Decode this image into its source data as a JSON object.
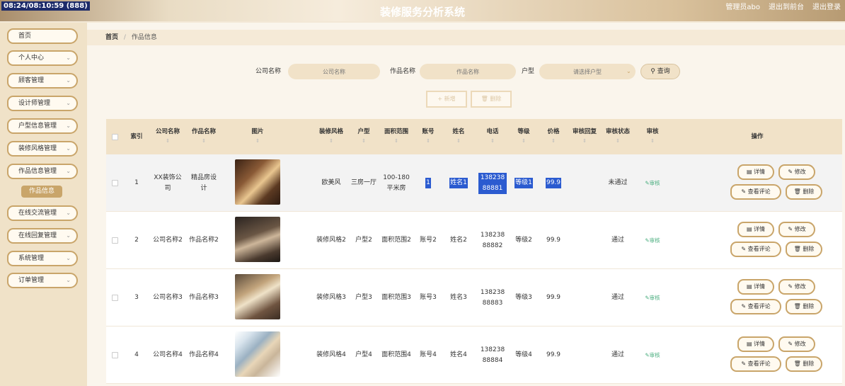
{
  "header": {
    "clock": "08:24/08:10:59 (888)",
    "title": "装修服务分析系统",
    "admin": "管理员abo",
    "back_to_front": "退出到前台",
    "logout": "退出登录"
  },
  "sidebar": {
    "items": [
      {
        "label": "首页",
        "has_arrow": false
      },
      {
        "label": "个人中心",
        "has_arrow": true
      },
      {
        "label": "顾客管理",
        "has_arrow": true
      },
      {
        "label": "设计师管理",
        "has_arrow": true
      },
      {
        "label": "户型信息管理",
        "has_arrow": true
      },
      {
        "label": "装修风格管理",
        "has_arrow": true
      },
      {
        "label": "作品信息管理",
        "has_arrow": true
      },
      {
        "label": "在线交流管理",
        "has_arrow": true
      },
      {
        "label": "在线回复管理",
        "has_arrow": true
      },
      {
        "label": "系统管理",
        "has_arrow": true
      },
      {
        "label": "订单管理",
        "has_arrow": true
      }
    ],
    "sub_active": "作品信息"
  },
  "breadcrumb": {
    "home": "首页",
    "sep": "/",
    "current": "作品信息"
  },
  "search": {
    "company_label": "公司名称",
    "company_placeholder": "公司名称",
    "work_label": "作品名称",
    "work_placeholder": "作品名称",
    "type_label": "户型",
    "type_placeholder": "请选择户型",
    "query_button": "查询"
  },
  "toolbar": {
    "add_label": "+ 新增",
    "delete_label": "删除"
  },
  "table": {
    "headers": [
      "索引",
      "公司名称",
      "作品名称",
      "图片",
      "装修风格",
      "户型",
      "面积范围",
      "账号",
      "姓名",
      "电话",
      "等级",
      "价格",
      "审核回复",
      "审核状态",
      "审核",
      "操作"
    ],
    "rows": [
      {
        "index": "1",
        "company": "XX装饰公司",
        "work": "精品房设计",
        "style": "欧美风",
        "type": "三房一厅",
        "area": "100-180平米房",
        "account": "1",
        "name": "姓名1",
        "phone": "13823888881",
        "level": "等级1",
        "price": "99.9",
        "reply": "",
        "status": "未通过",
        "audit": "审核"
      },
      {
        "index": "2",
        "company": "公司名称2",
        "work": "作品名称2",
        "style": "装修风格2",
        "type": "户型2",
        "area": "面积范围2",
        "account": "账号2",
        "name": "姓名2",
        "phone": "13823888882",
        "level": "等级2",
        "price": "99.9",
        "reply": "",
        "status": "通过",
        "audit": "审核"
      },
      {
        "index": "3",
        "company": "公司名称3",
        "work": "作品名称3",
        "style": "装修风格3",
        "type": "户型3",
        "area": "面积范围3",
        "account": "账号3",
        "name": "姓名3",
        "phone": "13823888883",
        "level": "等级3",
        "price": "99.9",
        "reply": "",
        "status": "通过",
        "audit": "审核"
      },
      {
        "index": "4",
        "company": "公司名称4",
        "work": "作品名称4",
        "style": "装修风格4",
        "type": "户型4",
        "area": "面积范围4",
        "account": "账号4",
        "name": "姓名4",
        "phone": "13823888884",
        "level": "等级4",
        "price": "99.9",
        "reply": "",
        "status": "通过",
        "audit": "审核"
      }
    ],
    "actions": {
      "detail": "详情",
      "edit": "修改",
      "comments": "查看评论",
      "delete": "删除"
    }
  },
  "colors": {
    "accent": "#c9a56a",
    "header_bg": "#f1e2c8",
    "selection": "#2b5bd0",
    "audit": "#4caf80"
  }
}
